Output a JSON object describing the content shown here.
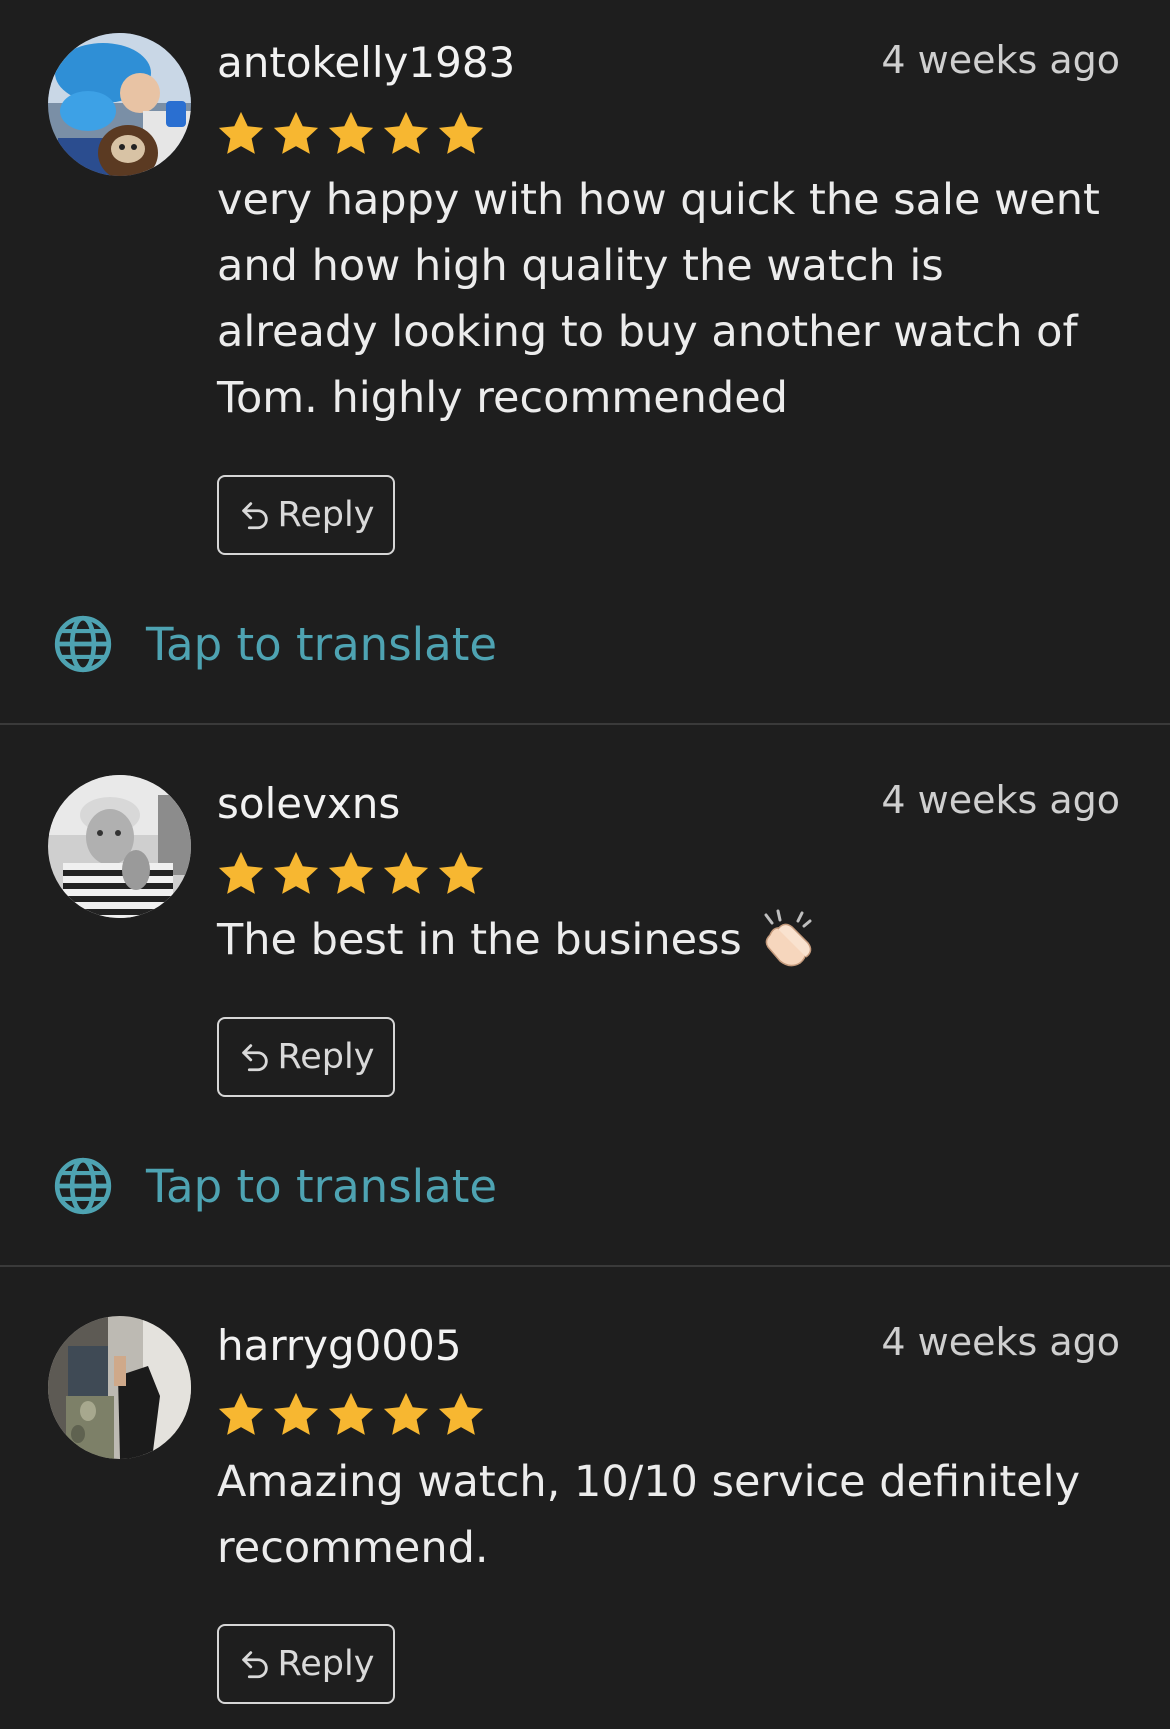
{
  "reviews": [
    {
      "username": "antokelly1983",
      "timestamp": "4 weeks ago",
      "rating": 5,
      "text_lines": [
        "very happy with how quick the sale went",
        "and how high quality the watch is",
        "already looking to buy another watch of",
        "Tom. highly recommended"
      ],
      "avatar_icon": "child-with-cake-avatar",
      "reply_label": "Reply",
      "translate_label": "Tap to translate"
    },
    {
      "username": "solevxns",
      "timestamp": "4 weeks ago",
      "rating": 5,
      "text_lines": [
        "The best in the business"
      ],
      "emoji": "clapping-hands",
      "avatar_icon": "man-in-striped-shirt-avatar",
      "reply_label": "Reply",
      "translate_label": "Tap to translate"
    },
    {
      "username": "harryg0005",
      "timestamp": "4 weeks ago",
      "rating": 5,
      "text_lines": [
        "Amazing watch, 10/10 service definitely",
        "recommend."
      ],
      "avatar_icon": "mirror-selfie-avatar",
      "reply_label": "Reply"
    }
  ],
  "colors": {
    "background": "#1e1e1e",
    "star": "#f7b731",
    "translate": "#4ea3b2",
    "divider": "#3a3a3a"
  }
}
